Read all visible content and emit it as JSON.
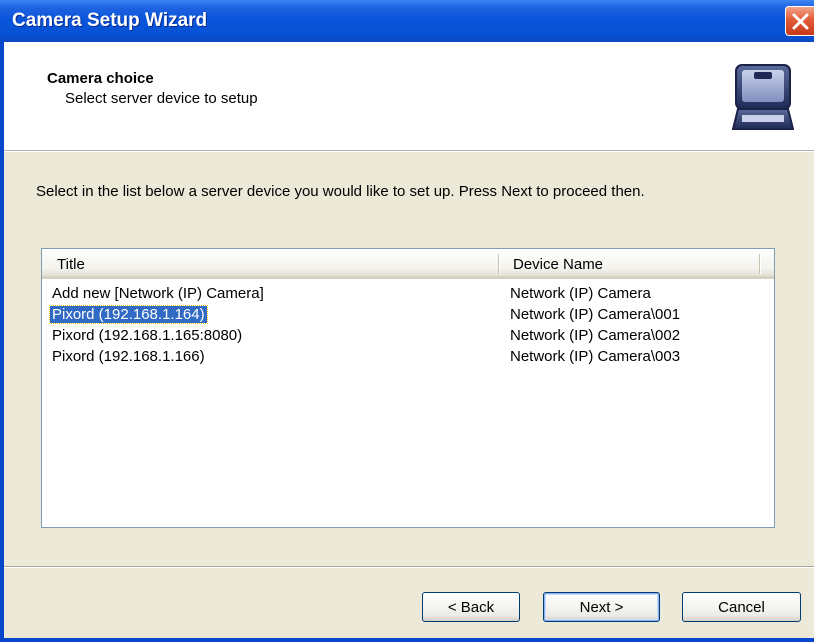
{
  "window": {
    "title": "Camera Setup Wizard"
  },
  "header": {
    "title": "Camera choice",
    "subtitle": "Select server device to setup",
    "icon": "camera-device-icon"
  },
  "instruction": "Select in the list below a server device you would like to set up. Press Next to proceed then.",
  "list": {
    "columns": [
      "Title",
      "Device Name"
    ],
    "rows": [
      {
        "title": "Add new [Network (IP) Camera]",
        "device": "Network (IP) Camera",
        "selected": false
      },
      {
        "title": "Pixord (192.168.1.164)",
        "device": "Network (IP) Camera\\001",
        "selected": true
      },
      {
        "title": "Pixord (192.168.1.165:8080)",
        "device": "Network (IP) Camera\\002",
        "selected": false
      },
      {
        "title": "Pixord (192.168.1.166)",
        "device": "Network (IP) Camera\\003",
        "selected": false
      }
    ]
  },
  "buttons": {
    "back": "< Back",
    "next": "Next >",
    "cancel": "Cancel"
  },
  "colors": {
    "titlebar": "#0a55dc",
    "selection": "#316ac5",
    "dialog_bg": "#ece9d8"
  }
}
